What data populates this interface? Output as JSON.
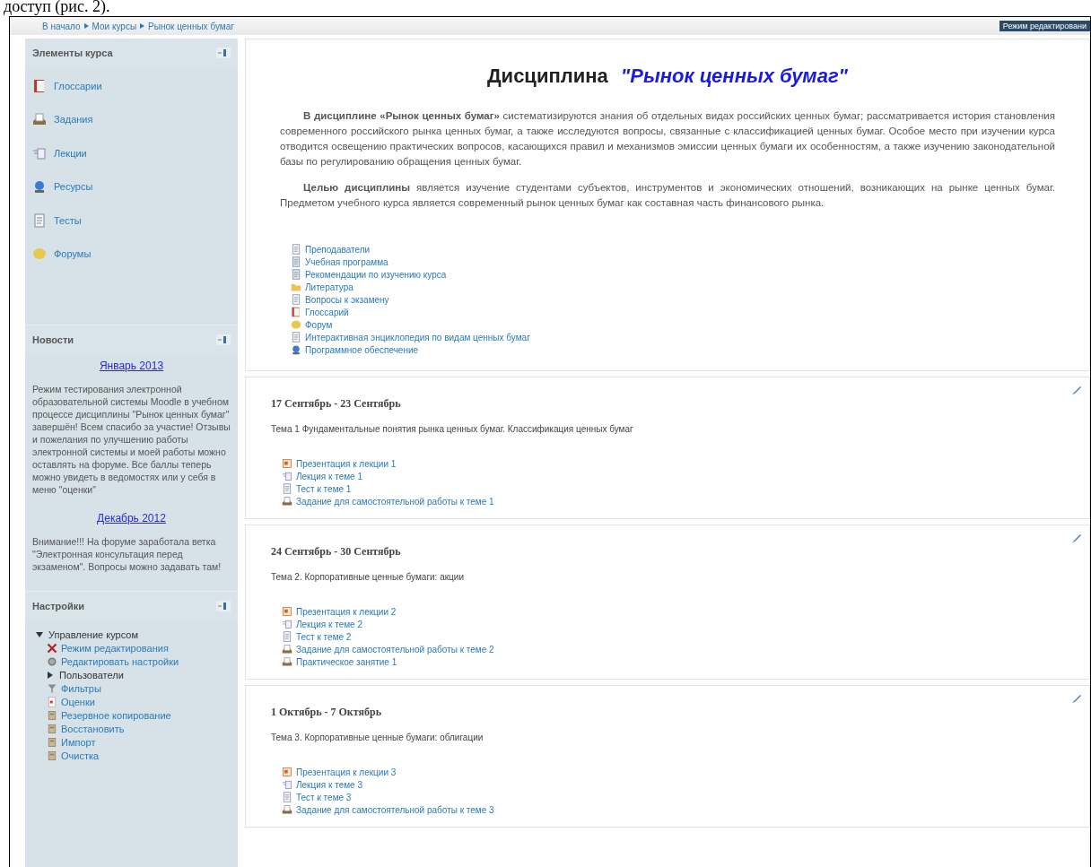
{
  "document_text": "доступ (рис. 2).",
  "breadcrumb": [
    "В начало",
    "Мои курсы",
    "Рынок ценных бумаг"
  ],
  "edit_mode_button": "Режим редактировани",
  "course_elements": {
    "title": "Элементы курса",
    "items": [
      {
        "label": "Глоссарии",
        "kind": "glossary"
      },
      {
        "label": "Задания",
        "kind": "assignment"
      },
      {
        "label": "Лекции",
        "kind": "lecture"
      },
      {
        "label": "Ресурсы",
        "kind": "resource"
      },
      {
        "label": "Тесты",
        "kind": "test"
      },
      {
        "label": "Форумы",
        "kind": "forum"
      }
    ]
  },
  "news": {
    "title": "Новости",
    "entries": [
      {
        "date": "Январь 2013",
        "text": "Режим тестирования электронной образовательной системы Moodle в учебном процессе дисциплины \"Рынок ценных бумаг\" завершён! Всем спасибо за участие! Отзывы и пожелания по улучшению работы электронной системы и моей работы можно оставлять на форуме. Все баллы теперь можно увидеть в ведомостях или у себя в меню \"оценки\""
      },
      {
        "date": "Декабрь 2012",
        "text": "Внимание!!! На форуме заработала ветка \"Электронная консультация перед экзаменом\". Вопросы можно задавать там!"
      }
    ]
  },
  "settings": {
    "title": "Настройки",
    "tree": [
      {
        "label": "Управление курсом",
        "kind": "branch",
        "expanded": true,
        "children": [
          {
            "label": "Режим редактирования",
            "kind": "edit"
          },
          {
            "label": "Редактировать настройки",
            "kind": "settings"
          },
          {
            "label": "Пользователи",
            "kind": "branch",
            "expanded": false
          },
          {
            "label": "Фильтры",
            "kind": "filter"
          },
          {
            "label": "Оценки",
            "kind": "grades"
          },
          {
            "label": "Резервное копирование",
            "kind": "backup"
          },
          {
            "label": "Восстановить",
            "kind": "restore"
          },
          {
            "label": "Импорт",
            "kind": "import"
          },
          {
            "label": "Очистка",
            "kind": "clean"
          }
        ]
      }
    ]
  },
  "course": {
    "title_prefix": "Дисциплина",
    "title_name": "\"Рынок ценных бумаг\"",
    "paragraphs": [
      "**В дисциплине «Рынок ценных бумаг»** систематизируются знания об отдельных видах российских ценных бумаг; рассматривается история становления современного российского рынка ценных бумаг, а также исследуются вопросы, связанные с классификацией ценных бумаг. Особое место при изучении курса отводится освещению практических вопросов, касающихся правил и механизмов эмиссии ценных бумаги их особенностям, а также изучению законодательной базы по регулированию обращения ценных бумаг.",
      "**Целью дисциплины** является изучение студентами субъектов, инструментов и экономических отношений, возникающих на рынке ценных бумаг. Предметом учебного курса является современный рынок ценных бумаг как составная часть финансового рынка."
    ],
    "links": [
      {
        "label": "Преподаватели",
        "kind": "page"
      },
      {
        "label": "Учебная программа",
        "kind": "doc"
      },
      {
        "label": "Рекомендации по изучению курса",
        "kind": "doc"
      },
      {
        "label": "Литература",
        "kind": "folder"
      },
      {
        "label": "Вопросы к экзамену",
        "kind": "page"
      },
      {
        "label": "Глоссарий",
        "kind": "glossary"
      },
      {
        "label": "Форум",
        "kind": "forum"
      },
      {
        "label": "Интерактивная энциклопедия по видам ценных бумаг",
        "kind": "page"
      },
      {
        "label": "Программное обеспечение",
        "kind": "resource"
      }
    ]
  },
  "weeks": [
    {
      "dates": "17 Сентябрь - 23 Сентябрь",
      "topic": "Тема 1 Фундаментальные понятия рынка ценных бумаг. Классификация ценных бумаг",
      "activities": [
        {
          "label": "Презентация к лекции 1",
          "kind": "presentation"
        },
        {
          "label": "Лекция к теме 1",
          "kind": "lecture"
        },
        {
          "label": "Тест к теме 1",
          "kind": "test"
        },
        {
          "label": "Задание для самостоятельной работы к теме 1",
          "kind": "assignment"
        }
      ]
    },
    {
      "dates": "24 Сентябрь - 30 Сентябрь",
      "topic": "Тема 2. Корпоративные ценные бумаги: акции",
      "activities": [
        {
          "label": "Презентация к лекции 2",
          "kind": "presentation"
        },
        {
          "label": "Лекция к теме 2",
          "kind": "lecture"
        },
        {
          "label": "Тест к теме 2",
          "kind": "test"
        },
        {
          "label": "Задание для самостоятельной работы к теме 2",
          "kind": "assignment"
        },
        {
          "label": "Практическое занятие 1",
          "kind": "assignment"
        }
      ]
    },
    {
      "dates": "1 Октябрь - 7 Октябрь",
      "topic": "Тема 3. Корпоративные ценные бумаги: облигации",
      "activities": [
        {
          "label": "Презентация к лекции 3",
          "kind": "presentation"
        },
        {
          "label": "Лекция к теме 3",
          "kind": "lecture"
        },
        {
          "label": "Тест к теме 3",
          "kind": "test"
        },
        {
          "label": "Задание для самостоятельной работы к теме 3",
          "kind": "assignment"
        }
      ]
    }
  ]
}
